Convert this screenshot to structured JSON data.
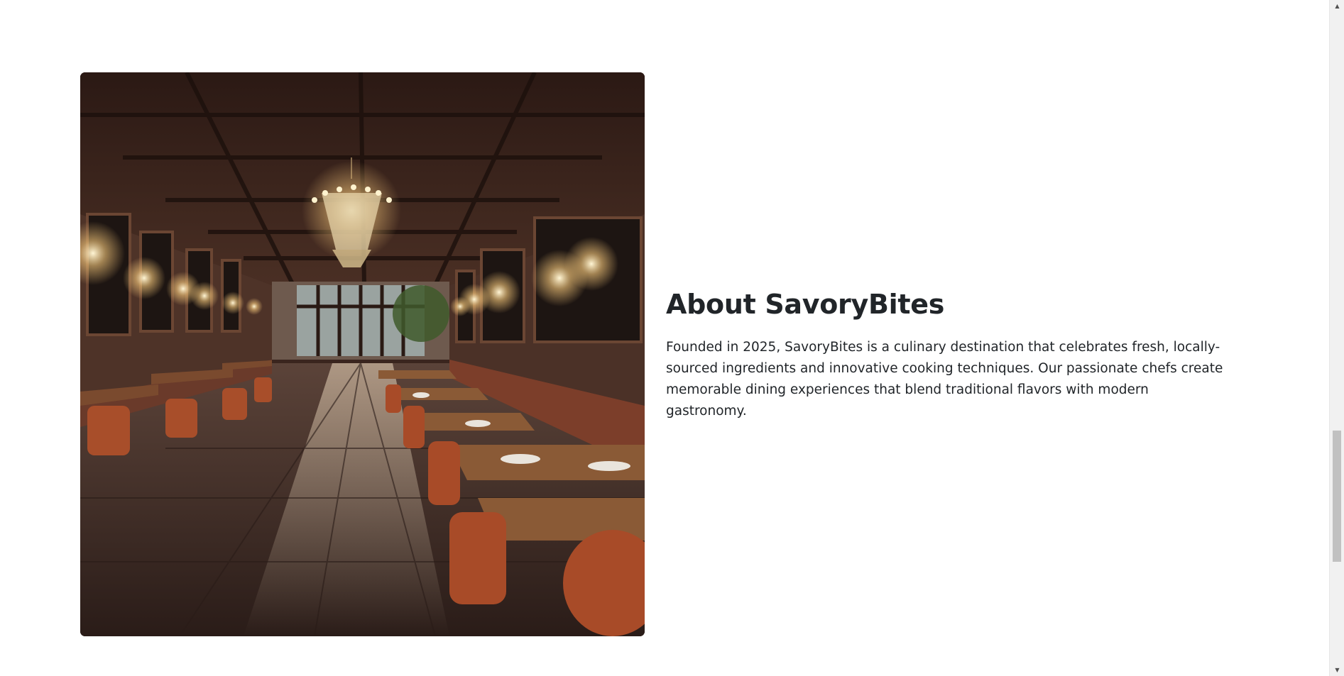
{
  "about": {
    "title": "About SavoryBites",
    "body": "Founded in 2025, SavoryBites is a culinary destination that celebrates fresh, locally-sourced ingredients and innovative cooking techniques. Our passionate chefs create memorable dining experiences that blend traditional flavors with modern gastronomy.",
    "image_description": "restaurant-interior-image"
  },
  "scrollbar": {
    "up_icon": "triangle-up-icon",
    "down_icon": "triangle-down-icon"
  }
}
